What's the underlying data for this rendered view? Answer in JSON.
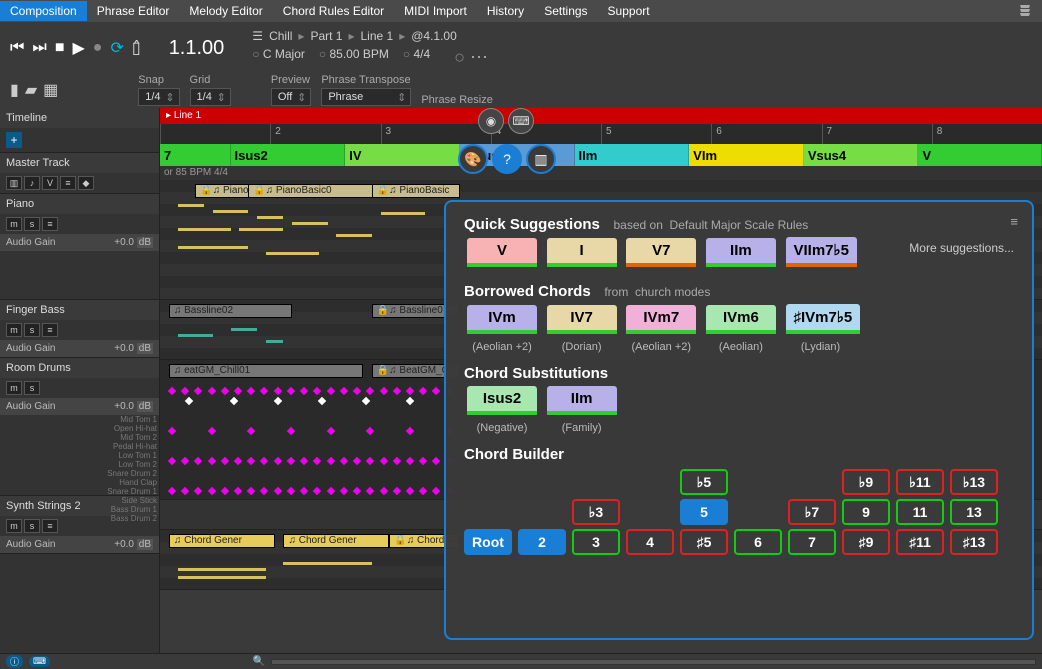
{
  "menu": {
    "items": [
      "Composition",
      "Phrase Editor",
      "Melody Editor",
      "Chord Rules Editor",
      "MIDI Import",
      "History",
      "Settings",
      "Support"
    ],
    "active": 0
  },
  "transport": {
    "time": "1.1.00",
    "breadcrumb": [
      "Chill",
      "Part 1",
      "Line 1",
      "@4.1.00"
    ],
    "key": "C Major",
    "bpm": "85.00 BPM",
    "sig": "4/4"
  },
  "controls": {
    "snap_label": "Snap",
    "snap_value": "1/4",
    "grid_label": "Grid",
    "grid_value": "1/4",
    "preview_label": "Preview",
    "preview_value": "Off",
    "transpose_label": "Phrase Transpose",
    "transpose_value": "Phrase",
    "resize_label": "Phrase Resize"
  },
  "timeline_label": "Timeline",
  "master_track_label": "Master Track",
  "master_meta": "or  85 BPM  4/4",
  "line_label": "Line 1",
  "ruler_ticks": [
    "",
    "2",
    "3",
    "4",
    "5",
    "6",
    "7",
    "8"
  ],
  "chord_strip": [
    {
      "label": "7",
      "color": "green",
      "w": 10
    },
    {
      "label": "Isus2",
      "color": "green",
      "w": 14
    },
    {
      "label": "IV",
      "color": "lime",
      "w": 14
    },
    {
      "label": "IVsus2",
      "color": "sel",
      "w": 14
    },
    {
      "label": "IIm",
      "color": "teal",
      "w": 14
    },
    {
      "label": "VIm",
      "color": "yellow",
      "w": 14
    },
    {
      "label": "Vsus4",
      "color": "lime",
      "w": 14
    },
    {
      "label": "V",
      "color": "green",
      "w": 14
    }
  ],
  "tracks": [
    {
      "name": "Piano",
      "gain": "+0.0",
      "unit": "dB",
      "buttons": [
        "m",
        "s",
        "≡"
      ],
      "clips": [
        "PianoBasic0",
        "PianoBasic0",
        "PianoBasic"
      ]
    },
    {
      "name": "Finger Bass",
      "gain": "+0.0",
      "unit": "dB",
      "buttons": [
        "m",
        "s",
        "≡"
      ],
      "clips": [
        "Bassline02",
        "Bassline0"
      ]
    },
    {
      "name": "Room Drums",
      "gain": "+0.0",
      "unit": "dB",
      "buttons": [
        "m",
        "s"
      ],
      "clips": [
        "eatGM_Chill01",
        "BeatGM_Ch"
      ],
      "drumLabels": [
        "Mid Tom 1",
        "Open Hi-hat",
        "Mid Tom 2",
        "Pedal Hi-hat",
        "Low Tom 1",
        "Low Tom 2",
        "Snare Drum 2",
        "Hand Clap",
        "Snare Drum 1",
        "Side Stick",
        "Bass Drum 1",
        "Bass Drum 2"
      ]
    },
    {
      "name": "Synth Strings 2",
      "gain": "+0.0",
      "unit": "dB",
      "buttons": [
        "m",
        "s",
        "≡"
      ],
      "clips": [
        "Chord Gener",
        "Chord Gener",
        "Chord Gen"
      ]
    }
  ],
  "popup": {
    "quick_title": "Quick Suggestions",
    "quick_sub1": "based on",
    "quick_sub2": "Default Major Scale Rules",
    "quick": [
      {
        "label": "V",
        "cls": "pink"
      },
      {
        "label": "I",
        "cls": "tan"
      },
      {
        "label": "V7",
        "cls": "tan2"
      },
      {
        "label": "IIm",
        "cls": "lav"
      },
      {
        "label": "VIIm7♭5",
        "cls": "lav2"
      }
    ],
    "more": "More suggestions...",
    "borrowed_title": "Borrowed Chords",
    "borrowed_sub1": "from",
    "borrowed_sub2": "church modes",
    "borrowed": [
      {
        "label": "IVm",
        "cls": "lav",
        "caption": "(Aeolian +2)"
      },
      {
        "label": "IV7",
        "cls": "tan",
        "caption": "(Dorian)"
      },
      {
        "label": "IVm7",
        "cls": "pink2",
        "caption": "(Aeolian +2)"
      },
      {
        "label": "IVm6",
        "cls": "green",
        "caption": "(Aeolian)"
      },
      {
        "label": "♯IVm7♭5",
        "cls": "blue",
        "caption": "(Lydian)"
      }
    ],
    "subs_title": "Chord Substitutions",
    "subs": [
      {
        "label": "Isus2",
        "cls": "green",
        "caption": "(Negative)"
      },
      {
        "label": "IIm",
        "cls": "lav",
        "caption": "(Family)"
      }
    ],
    "builder_title": "Chord Builder",
    "builder": {
      "root": "Root",
      "c2": "2",
      "c_b3": "♭3",
      "c_3": "3",
      "c_4": "4",
      "c_b5": "♭5",
      "c_5": "5",
      "c_s5": "♯5",
      "c_6": "6",
      "c_b7": "♭7",
      "c_7": "7",
      "c_b9": "♭9",
      "c_9": "9",
      "c_s9": "♯9",
      "c_b11": "♭11",
      "c_11": "11",
      "c_s11": "♯11",
      "c_b13": "♭13",
      "c_13": "13",
      "c_s13": "♯13"
    }
  },
  "gain_label": "Audio Gain"
}
